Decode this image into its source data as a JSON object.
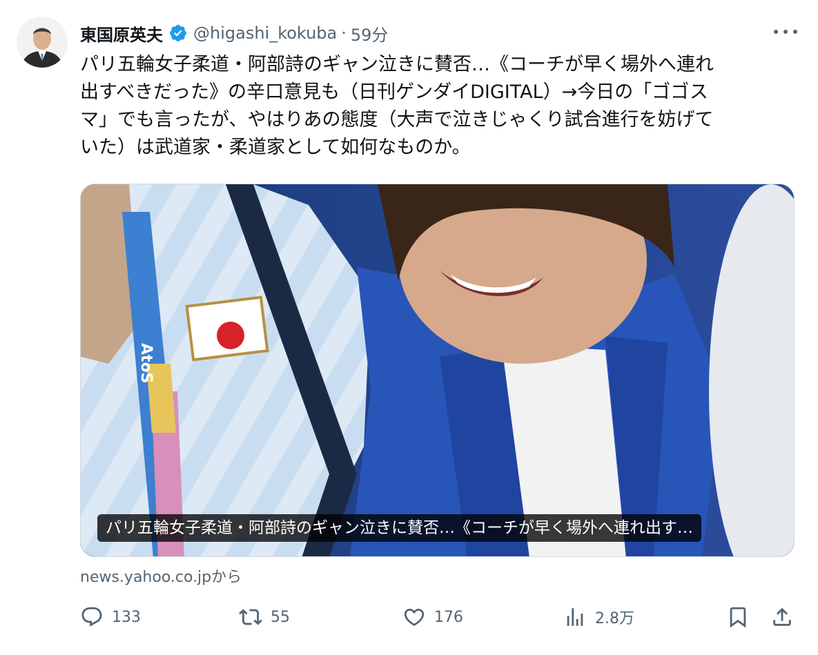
{
  "author": {
    "name": "東国原英夫",
    "handle": "@higashi_kokuba",
    "separator": "·",
    "time": "59分"
  },
  "tweet": {
    "text": "パリ五輪女子柔道・阿部詩のギャン泣きに賛否…《コーチが早く場外へ連れ\n出すべきだった》の辛口意見も（日刊ゲンダイDIGITAL）→今日の「ゴゴス\nマ」でも言ったが、やはりあの態度（大声で泣きじゃくり試合進行を妨げて\nいた）は武道家・柔道家として如何なものか。"
  },
  "card": {
    "caption": "パリ五輪女子柔道・阿部詩のギャン泣きに賛否…《コーチが早く場外へ連れ出す…",
    "source": "news.yahoo.co.jpから",
    "photo_text": "AtoS"
  },
  "actions": {
    "reply_count": "133",
    "retweet_count": "55",
    "like_count": "176",
    "view_count": "2.8万"
  },
  "icons": {
    "verified": "verified-badge-icon",
    "more": "more-options-icon",
    "reply": "reply-icon",
    "retweet": "retweet-icon",
    "like": "like-icon",
    "views": "views-icon",
    "bookmark": "bookmark-icon",
    "share": "share-icon"
  },
  "colors": {
    "verified": "#1d9bf0",
    "secondary_text": "#536471",
    "primary_text": "#0f1419",
    "border": "#cfd9de"
  }
}
